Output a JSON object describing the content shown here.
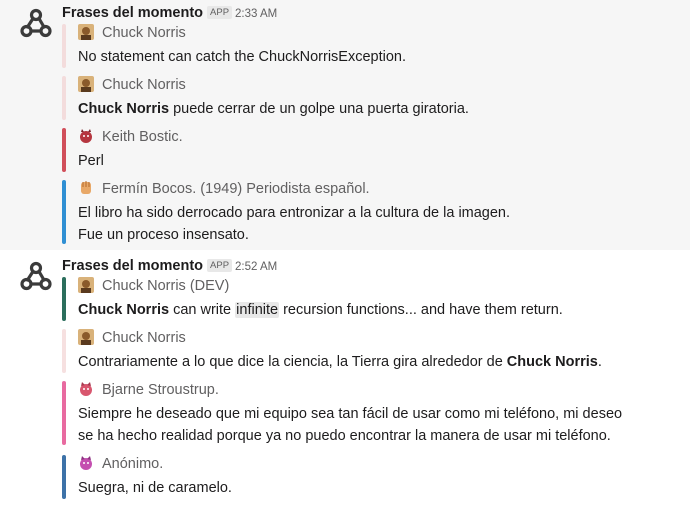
{
  "messages": [
    {
      "sender": "Frases del momento",
      "badge": "APP",
      "time": "2:33 AM",
      "attachments": [
        {
          "author": "Chuck Norris",
          "color": "#e8d5b0",
          "bar_color": "#fbe3e3",
          "text": "No statement can catch the ChuckNorrisException."
        },
        {
          "author": "Chuck Norris",
          "bar_color": "#fbe3e3",
          "text_bold": "Chuck Norris",
          "text_rest": " puede cerrar de un golpe una puerta giratoria."
        },
        {
          "author": "Keith Bostic.",
          "bar_color": "#d14f5a",
          "text": "Perl"
        },
        {
          "author": "Fermín Bocos. (1949) Periodista español.",
          "bar_color": "#3b8fd1",
          "text_line1": "El libro ha sido derrocado para entronizar a la cultura de la imagen.",
          "text_line2": "Fue un proceso insensato."
        }
      ]
    },
    {
      "sender": "Frases del momento",
      "badge": "APP",
      "time": "2:52 AM",
      "attachments": [
        {
          "author": "Chuck Norris (DEV)",
          "bar_color": "#2f6a5a",
          "text_bold": "Chuck Norris",
          "text_mid": " can write ",
          "text_code": "infinite",
          "text_rest": " recursion functions... and have them return."
        },
        {
          "author": "Chuck Norris",
          "bar_color": "#fbe3e3",
          "text_pre": "Contrariamente a lo que dice la ciencia, la Tierra gira alrededor de ",
          "text_bold": "Chuck Norris",
          "text_rest": "."
        },
        {
          "author": "Bjarne Stroustrup.",
          "bar_color": "#e86aa0",
          "text_line1": "Siempre he deseado que mi equipo sea tan fácil de usar como mi teléfono, mi deseo",
          "text_line2": "se ha hecho realidad porque ya no puedo encontrar la manera de usar mi teléfono."
        },
        {
          "author": "Anónimo.",
          "bar_color": "#3b6fa6",
          "text": "Suegra, ni de caramelo."
        }
      ]
    }
  ],
  "icons": {
    "avatar": "webhook-icon",
    "reaction": "raised-hand-icon"
  },
  "colors": {
    "highlight_bg": "#f6f6f6",
    "muted_text": "#616061"
  }
}
